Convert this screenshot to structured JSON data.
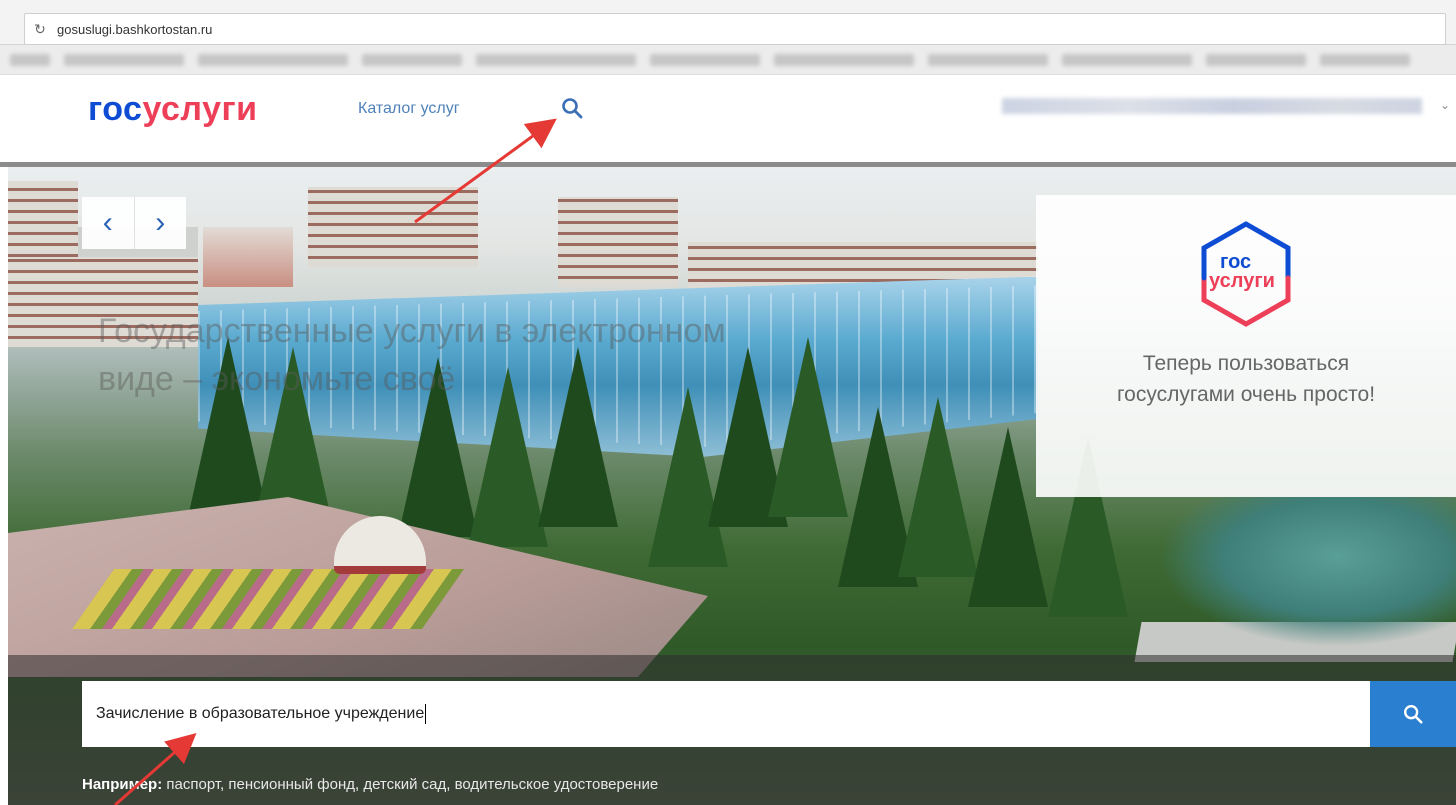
{
  "browser": {
    "url": "gosuslugi.bashkortostan.ru"
  },
  "header": {
    "logo_part1": "гос",
    "logo_part2": "услуги",
    "catalog_link": "Каталог услуг",
    "search_icon": "search-icon"
  },
  "hero": {
    "faded_headline": "Государственные услуги в электронном виде – экономьте своё",
    "card": {
      "logo_top": "гос",
      "logo_bottom": "услуги",
      "text": "Теперь пользоваться госуслугами очень просто!"
    },
    "nav": {
      "prev": "‹",
      "next": "›"
    }
  },
  "search": {
    "value": "Зачисление в образовательное учреждение",
    "examples_label": "Например:",
    "examples": [
      "паспорт",
      "пенсионный фонд",
      "детский сад",
      "водительское удостоверение"
    ]
  },
  "colors": {
    "brand_blue": "#0d4cd3",
    "brand_red": "#ee3f58",
    "link": "#4f81b9",
    "search_button": "#2b7fd1",
    "annotation_arrow": "#e53935"
  }
}
